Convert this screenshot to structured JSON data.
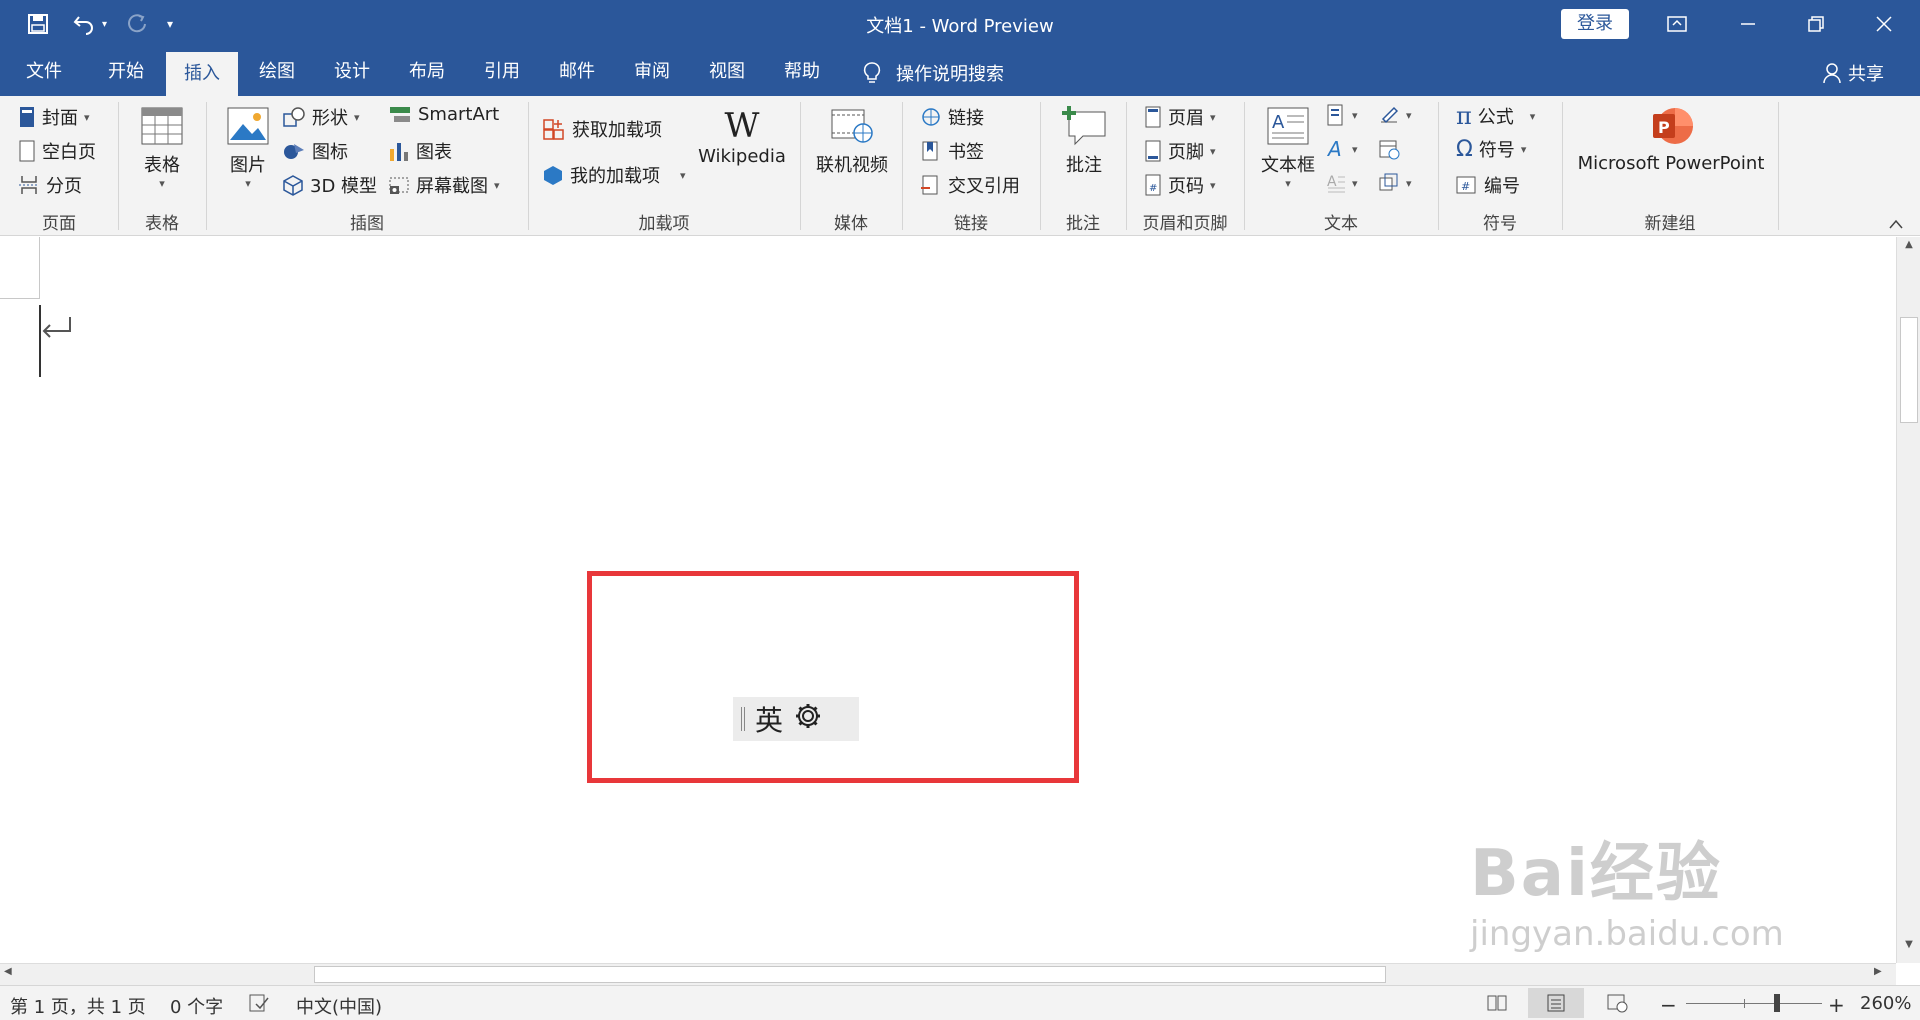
{
  "app": {
    "title": "文档1  -  Word Preview",
    "login": "登录"
  },
  "tabs": [
    {
      "label": "文件"
    },
    {
      "label": "开始"
    },
    {
      "label": "插入"
    },
    {
      "label": "绘图"
    },
    {
      "label": "设计"
    },
    {
      "label": "布局"
    },
    {
      "label": "引用"
    },
    {
      "label": "邮件"
    },
    {
      "label": "审阅"
    },
    {
      "label": "视图"
    },
    {
      "label": "帮助"
    }
  ],
  "search_label": "操作说明搜索",
  "share_label": "共享",
  "ribbon": {
    "pages": {
      "label": "页面",
      "items": [
        "封面",
        "空白页",
        "分页"
      ]
    },
    "tables": {
      "label": "表格",
      "button": "表格"
    },
    "illustrations": {
      "label": "插图",
      "picture": "图片",
      "items": [
        "形状",
        "图标",
        "3D 模型",
        "SmartArt",
        "图表",
        "屏幕截图"
      ]
    },
    "addins": {
      "label": "加载项",
      "items": [
        "获取加载项",
        "我的加载项"
      ],
      "wikipedia": "Wikipedia"
    },
    "media": {
      "label": "媒体",
      "button": "联机视频"
    },
    "links": {
      "label": "链接",
      "items": [
        "链接",
        "书签",
        "交叉引用"
      ]
    },
    "comments": {
      "label": "批注",
      "button": "批注"
    },
    "headerfooter": {
      "label": "页眉和页脚",
      "items": [
        "页眉",
        "页脚",
        "页码"
      ]
    },
    "text": {
      "label": "文本",
      "button": "文本框"
    },
    "symbols": {
      "label": "符号",
      "items": [
        "公式",
        "符号",
        "编号"
      ]
    },
    "newgroup": {
      "label": "新建组",
      "button": "Microsoft PowerPoint"
    }
  },
  "ime": {
    "mode": "英"
  },
  "statusbar": {
    "page": "第 1 页，共 1 页",
    "words": "0 个字",
    "language": "中文(中国)",
    "zoom": "260%"
  },
  "watermark": {
    "brand": "Bai经验",
    "url": "jingyan.baidu.com"
  },
  "colors": {
    "accent": "#2b579a",
    "highlight": "#e8373a"
  }
}
